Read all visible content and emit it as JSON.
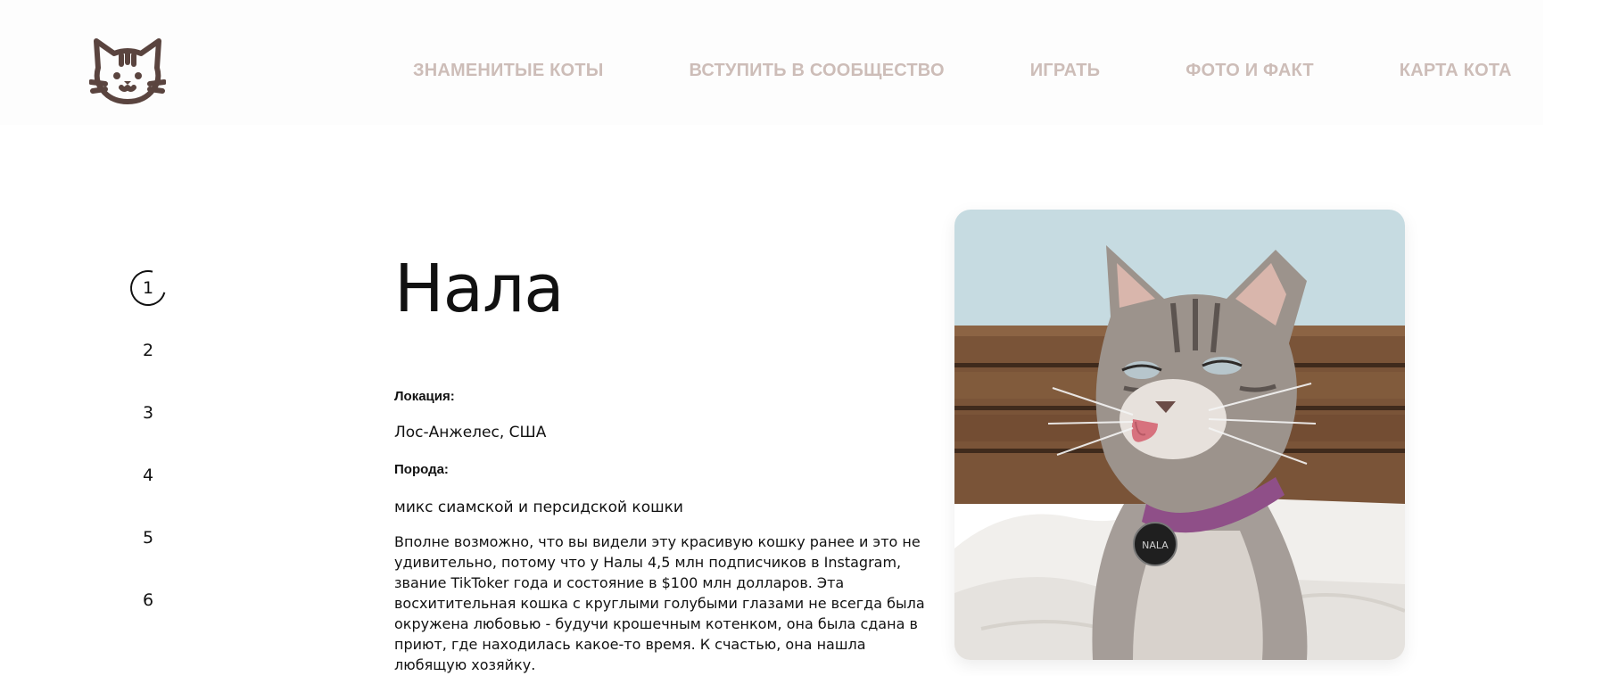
{
  "nav": {
    "items": [
      "ЗНАМЕНИТЫЕ КОТЫ",
      "ВСТУПИТЬ В СООБЩЕСТВО",
      "ИГРАТЬ",
      "ФОТО И ФАКТ",
      "КАРТА КОТА"
    ]
  },
  "logo": {
    "icon": "cat-face-icon",
    "color": "#5a443f"
  },
  "pager": {
    "items": [
      "1",
      "2",
      "3",
      "4",
      "5",
      "6"
    ],
    "active": "1"
  },
  "cat": {
    "name": "Нала",
    "location_label": "Локация:",
    "location": "Лос-Анжелес, США",
    "breed_label": "Порода:",
    "breed": "микс сиамской и персидской кошки",
    "description": "Вполне возможно, что вы видели эту красивую кошку ранее и это не удивительно, потому что у Налы 4,5 млн подписчиков в Instagram, звание TikToker года и состояние в $100 млн долларов. Эта восхитительная кошка с круглыми голубыми глазами не всегда была окружена любовью - будучи крошечным котенком, она была сдана в приют, где находилась какое-то время. К счастью, она нашла любящую хозяйку.",
    "collar_tag": "NALA"
  },
  "colors": {
    "nav_text": "#cdbdb8",
    "logo": "#5a443f",
    "text": "#111111"
  }
}
